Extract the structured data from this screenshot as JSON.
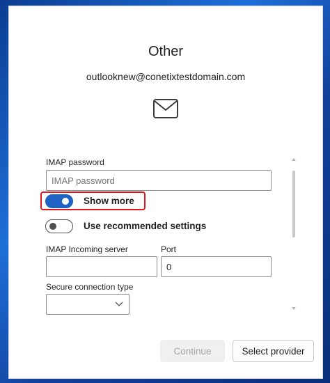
{
  "dialog": {
    "title": "Other",
    "email": "outlooknew@conetixtestdomain.com",
    "imap_password": {
      "label": "IMAP password",
      "placeholder": "IMAP password",
      "value": ""
    },
    "show_more": {
      "label": "Show more",
      "on": true
    },
    "recommended": {
      "label": "Use recommended settings",
      "on": false
    },
    "incoming_server": {
      "label": "IMAP Incoming server",
      "value": ""
    },
    "port": {
      "label": "Port",
      "value": "0"
    },
    "secure_type": {
      "label": "Secure connection type",
      "value": ""
    },
    "buttons": {
      "continue": "Continue",
      "select_provider": "Select provider"
    }
  },
  "colors": {
    "accent": "#1e62c4",
    "highlight": "#e0161f"
  }
}
